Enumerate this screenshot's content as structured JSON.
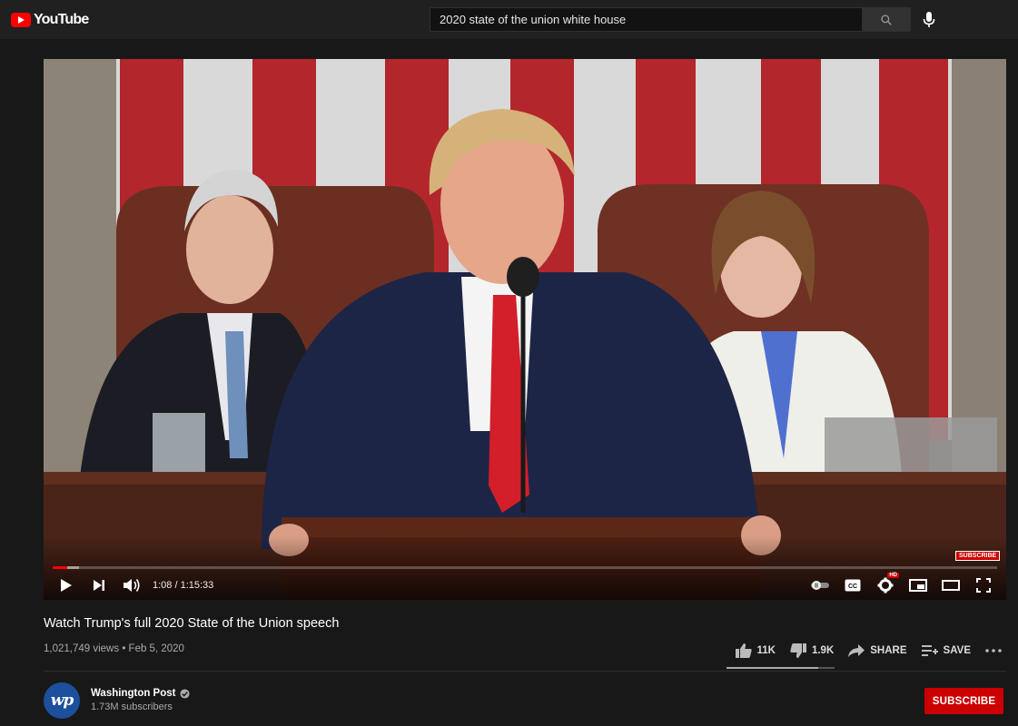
{
  "header": {
    "logo_text": "YouTube",
    "search_value": "2020 state of the union white house",
    "search_icon": "search-icon",
    "mic_icon": "mic-icon"
  },
  "player": {
    "time_current": "1:08",
    "time_separator": " / ",
    "time_total": "1:15:33",
    "progress_played_fraction": 0.015,
    "progress_loaded_fraction": 0.028,
    "watermark_label": "SUBSCRIBE",
    "hd_badge": "HD",
    "controls": [
      "play-icon",
      "next-icon",
      "volume-icon",
      "autoplay-toggle",
      "captions-icon",
      "settings-icon",
      "miniplayer-icon",
      "theater-icon",
      "fullscreen-icon"
    ]
  },
  "video": {
    "title": "Watch Trump's full 2020 State of the Union speech",
    "views": "1,021,749 views",
    "date_separator": " • ",
    "date": "Feb 5, 2020",
    "actions": {
      "likes": "11K",
      "dislikes": "1.9K",
      "share": "SHARE",
      "save": "SAVE"
    },
    "like_ratio": 0.85
  },
  "channel": {
    "avatar_text": "wp",
    "name": "Washington Post",
    "subscribers": "1.73M subscribers",
    "subscribe_label": "SUBSCRIBE"
  },
  "colors": {
    "brand_red": "#ff0000",
    "subscribe_red": "#cc0000",
    "background": "#181818",
    "topbar": "#202020"
  }
}
